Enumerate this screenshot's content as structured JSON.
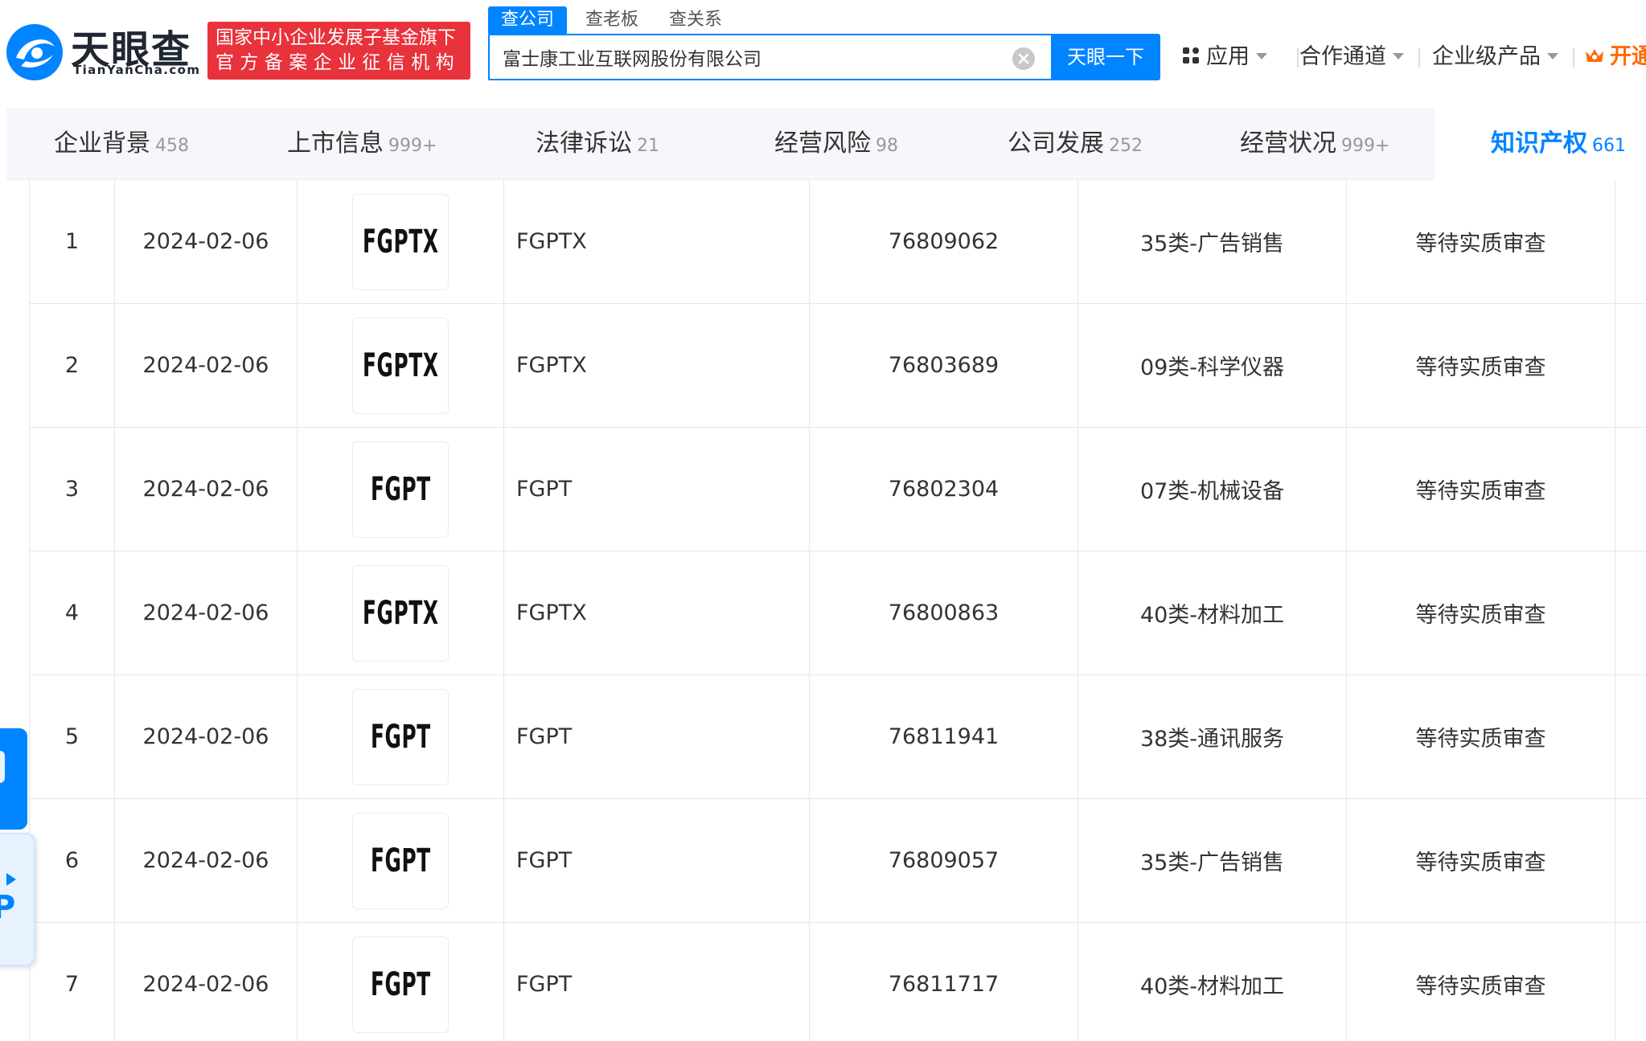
{
  "brand": {
    "name": "天眼查",
    "domain": "TianYanCha.com",
    "badge_line1": "国家中小企业发展子基金旗下",
    "badge_line2": "官方备案企业征信机构",
    "color": "#0084ff"
  },
  "search": {
    "tabs": [
      "查公司",
      "查老板",
      "查关系"
    ],
    "active_tab": "查公司",
    "query": "富士康工业互联网股份有限公司",
    "button_label": "天眼一下"
  },
  "nav": {
    "apps_label": "应用",
    "partner_label": "合作通道",
    "enterprise_label": "企业级产品",
    "open_label": "开通"
  },
  "tabs": [
    {
      "label": "企业背景",
      "count": "458"
    },
    {
      "label": "上市信息",
      "count": "999+"
    },
    {
      "label": "法律诉讼",
      "count": "21"
    },
    {
      "label": "经营风险",
      "count": "98"
    },
    {
      "label": "公司发展",
      "count": "252"
    },
    {
      "label": "经营状况",
      "count": "999+"
    },
    {
      "label": "知识产权",
      "count": "661"
    }
  ],
  "active_tab": "知识产权",
  "trademarks": [
    {
      "index": "1",
      "date": "2024-02-06",
      "logo_text": "FGPTX",
      "name": "FGPTX",
      "reg_no": "76809062",
      "class": "35类-广告销售",
      "status": "等待实质审查"
    },
    {
      "index": "2",
      "date": "2024-02-06",
      "logo_text": "FGPTX",
      "name": "FGPTX",
      "reg_no": "76803689",
      "class": "09类-科学仪器",
      "status": "等待实质审查"
    },
    {
      "index": "3",
      "date": "2024-02-06",
      "logo_text": "FGPT",
      "name": "FGPT",
      "reg_no": "76802304",
      "class": "07类-机械设备",
      "status": "等待实质审查"
    },
    {
      "index": "4",
      "date": "2024-02-06",
      "logo_text": "FGPTX",
      "name": "FGPTX",
      "reg_no": "76800863",
      "class": "40类-材料加工",
      "status": "等待实质审查"
    },
    {
      "index": "5",
      "date": "2024-02-06",
      "logo_text": "FGPT",
      "name": "FGPT",
      "reg_no": "76811941",
      "class": "38类-通讯服务",
      "status": "等待实质审查"
    },
    {
      "index": "6",
      "date": "2024-02-06",
      "logo_text": "FGPT",
      "name": "FGPT",
      "reg_no": "76809057",
      "class": "35类-广告销售",
      "status": "等待实质审查"
    },
    {
      "index": "7",
      "date": "2024-02-06",
      "logo_text": "FGPT",
      "name": "FGPT",
      "reg_no": "76811717",
      "class": "40类-材料加工",
      "status": "等待实质审查"
    }
  ],
  "side_widget": {
    "letter": "P"
  }
}
